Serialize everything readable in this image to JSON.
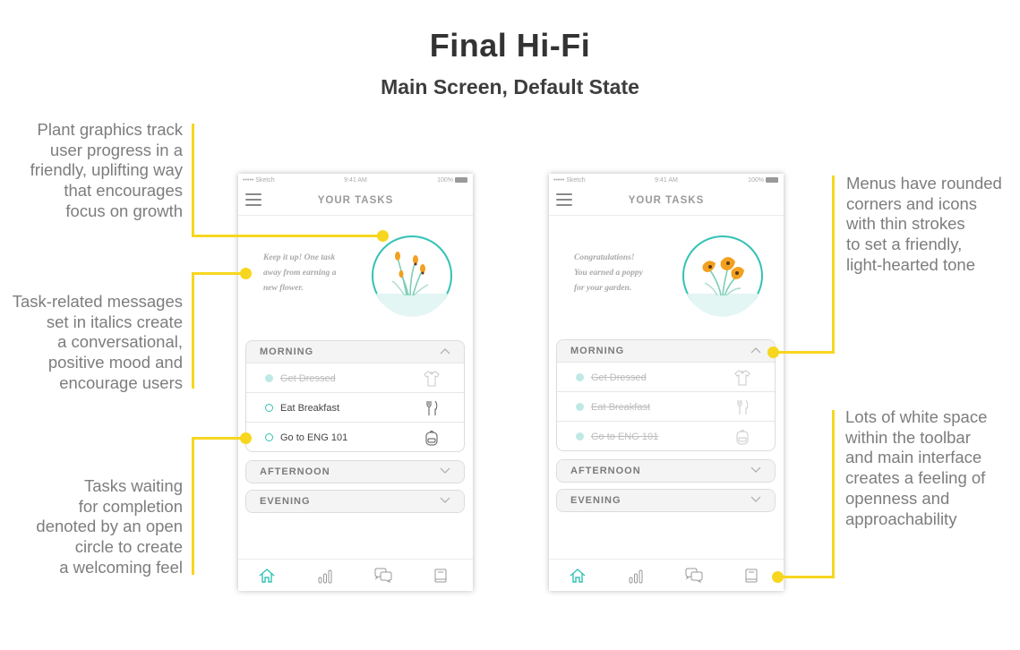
{
  "page": {
    "title": "Final Hi-Fi",
    "subtitle": "Main Screen, Default State"
  },
  "annotations": {
    "plant_graphics": [
      "Plant graphics track",
      "user progress in a",
      "friendly, uplifting way",
      "that encourages",
      "focus on growth"
    ],
    "task_messages": [
      "Task-related messages",
      "set in italics create",
      "a conversational,",
      "positive mood and",
      "encourage users"
    ],
    "tasks_waiting": [
      "Tasks waiting",
      "for completion",
      "denoted by an open",
      "circle to create",
      "a welcoming feel"
    ],
    "menus": [
      "Menus have rounded",
      "corners and icons",
      "with thin strokes",
      "to set a friendly,",
      "light-hearted tone"
    ],
    "white_space": [
      "Lots of white space",
      "within the toolbar",
      "and main interface",
      "creates a feeling of",
      "openness and",
      "approachability"
    ]
  },
  "colors": {
    "accent_yellow": "#f7d61f",
    "teal": "#32c2b4",
    "plant_orange": "#f2a01f"
  },
  "phone_left": {
    "status": {
      "carrier": "••••• Sketch",
      "time": "9:41 AM",
      "battery": "100%"
    },
    "app_title": "YOUR TASKS",
    "message": [
      "Keep it up! One task",
      "away from earning a",
      "new flower."
    ],
    "sections": {
      "morning": {
        "label": "MORNING",
        "tasks": [
          {
            "label": "Get Dressed",
            "done": true,
            "icon": "shirt-icon"
          },
          {
            "label": "Eat Breakfast",
            "done": false,
            "icon": "fork-knife-icon"
          },
          {
            "label": "Go to ENG 101",
            "done": false,
            "icon": "backpack-icon"
          }
        ]
      },
      "afternoon": {
        "label": "AFTERNOON"
      },
      "evening": {
        "label": "EVENING"
      }
    },
    "tabs": [
      "home-icon",
      "stats-icon",
      "chat-icon",
      "book-icon"
    ]
  },
  "phone_right": {
    "status": {
      "carrier": "••••• Sketch",
      "time": "9:41 AM",
      "battery": "100%"
    },
    "app_title": "YOUR TASKS",
    "message": [
      "Congratulations!",
      "You earned a poppy",
      "for your garden."
    ],
    "sections": {
      "morning": {
        "label": "MORNING",
        "tasks": [
          {
            "label": "Get Dressed",
            "done": true,
            "icon": "shirt-icon"
          },
          {
            "label": "Eat Breakfast",
            "done": true,
            "icon": "fork-knife-icon"
          },
          {
            "label": "Go to ENG 101",
            "done": true,
            "icon": "backpack-icon"
          }
        ]
      },
      "afternoon": {
        "label": "AFTERNOON"
      },
      "evening": {
        "label": "EVENING"
      }
    },
    "tabs": [
      "home-icon",
      "stats-icon",
      "chat-icon",
      "book-icon"
    ]
  }
}
